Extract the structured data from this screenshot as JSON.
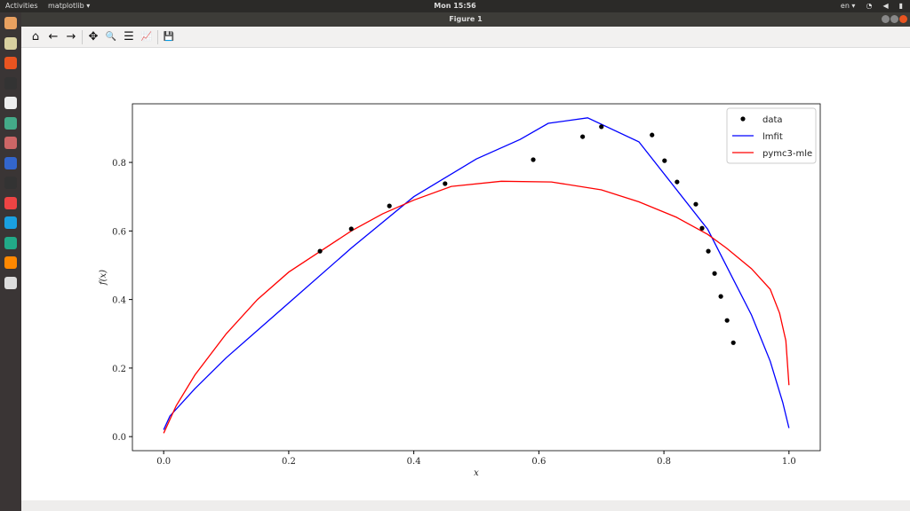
{
  "topbar": {
    "activities": "Activities",
    "app": "matplotlib ▾",
    "clock": "Mon 15:56",
    "lang": "en ▾",
    "wifi": "wifi-icon",
    "volume": "volume-icon",
    "battery": "battery-icon"
  },
  "window": {
    "title": "Figure 1"
  },
  "toolbar": {
    "home": "⌂",
    "back": "←",
    "forward": "→",
    "pan": "✥",
    "zoom": "🔍",
    "configure": "☰",
    "edit": "📈",
    "save": "💾"
  },
  "dock": {
    "items": [
      "files",
      "archive",
      "software",
      "terminal",
      "text-editor",
      "chrome",
      "settings",
      "jetbrains",
      "inkscape",
      "calc",
      "skype",
      "clion",
      "vlc",
      "spyder"
    ]
  },
  "chart_data": {
    "type": "line",
    "xlabel": "x",
    "ylabel": "f(x)",
    "xlim": [
      -0.05,
      1.05
    ],
    "ylim": [
      -0.041,
      0.971
    ],
    "xticks": [
      "0.0",
      "0.2",
      "0.4",
      "0.6",
      "0.8",
      "1.0"
    ],
    "yticks": [
      "0.0",
      "0.2",
      "0.4",
      "0.6",
      "0.8"
    ],
    "legend": {
      "placement": "top-right",
      "entries": [
        "data",
        "lmfit",
        "pymc3-mle"
      ]
    },
    "colors": {
      "data": "#000000",
      "lmfit": "#0000ff",
      "pymc3-mle": "#ff0000"
    },
    "data": {
      "x": [
        0.25,
        0.3,
        0.361,
        0.45,
        0.591,
        0.67,
        0.7,
        0.781,
        0.801,
        0.821,
        0.851,
        0.861,
        0.871,
        0.881,
        0.891,
        0.901,
        0.911
      ],
      "y": [
        0.541,
        0.606,
        0.673,
        0.738,
        0.808,
        0.875,
        0.904,
        0.88,
        0.805,
        0.743,
        0.678,
        0.608,
        0.541,
        0.476,
        0.409,
        0.339,
        0.274
      ]
    },
    "lmfit": {
      "x": [
        0,
        0.01,
        0.05,
        0.1,
        0.2,
        0.3,
        0.4,
        0.5,
        0.57,
        0.615,
        0.678,
        0.76,
        0.87,
        0.94,
        0.97,
        0.99,
        1.0
      ],
      "y": [
        0.02,
        0.06,
        0.14,
        0.23,
        0.39,
        0.55,
        0.7,
        0.81,
        0.867,
        0.914,
        0.93,
        0.86,
        0.605,
        0.355,
        0.22,
        0.1,
        0.025
      ]
    },
    "pymc3-mle": {
      "x": [
        0,
        0.02,
        0.05,
        0.1,
        0.15,
        0.2,
        0.3,
        0.35,
        0.4,
        0.46,
        0.54,
        0.62,
        0.7,
        0.76,
        0.82,
        0.87,
        0.9,
        0.94,
        0.97,
        0.985,
        0.995,
        1.0
      ],
      "y": [
        0.01,
        0.09,
        0.18,
        0.3,
        0.4,
        0.48,
        0.6,
        0.65,
        0.69,
        0.73,
        0.745,
        0.743,
        0.72,
        0.685,
        0.64,
        0.59,
        0.55,
        0.49,
        0.43,
        0.36,
        0.28,
        0.15
      ]
    }
  }
}
